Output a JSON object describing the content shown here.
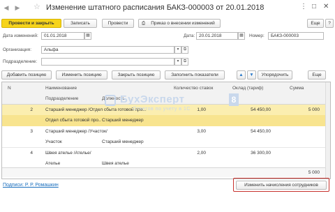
{
  "window": {
    "title": "Изменение штатного расписания БАКЗ-000003 от 20.01.2018",
    "back_icon": "arrow-left-icon",
    "forward_icon": "arrow-right-icon",
    "star_icon": "star-icon",
    "more_icon": "more-icon",
    "maximize_icon": "maximize-icon",
    "close_icon": "close-icon"
  },
  "toolbar": {
    "post_and_close": "Провести и закрыть",
    "save": "Записать",
    "post": "Провести",
    "order": "Приказ о внесении изменений",
    "more": "Еще",
    "help": "?"
  },
  "form": {
    "change_date_label": "Дата изменений:",
    "change_date_value": "01.01.2018",
    "date_label": "Дата:",
    "date_value": "20.01.2018",
    "number_label": "Номер:",
    "number_value": "БАКЗ-000003",
    "org_label": "Организация:",
    "org_value": "Альфа",
    "dept_label": "Подразделение:",
    "dept_value": ""
  },
  "table_toolbar": {
    "add": "Добавить позицию",
    "edit": "Изменить позицию",
    "close": "Закрыть позицию",
    "fill": "Заполнить показатели",
    "up_icon": "arrow-up-icon",
    "down_icon": "arrow-down-icon",
    "sort": "Упорядочить",
    "more": "Еще"
  },
  "table": {
    "headers": {
      "n": "N",
      "name": "Наименование",
      "dept": "Подразделение",
      "position": "Должность",
      "rates": "Количество ставок",
      "salary": "Оклад (тариф)",
      "sum": "Сумма"
    },
    "rows": [
      {
        "n": "2",
        "name": "Старший менеджер /Отдел сбыта готовой про...",
        "rates": "1,00",
        "salary": "54 450,00",
        "sum": "5 000",
        "dept": "Отдел сбыта готовой про...",
        "position": "Старший менеджер"
      },
      {
        "n": "3",
        "name": "Старший менеджер /Участок/",
        "rates": "3,00",
        "salary": "54 450,00",
        "sum": "",
        "dept": "Участок",
        "position": "Старший менеджер"
      },
      {
        "n": "4",
        "name": "Швея ателье /Ателье/",
        "rates": "2,00",
        "salary": "36 300,00",
        "sum": "",
        "dept": "Ателье",
        "position": "Швея ателье"
      }
    ],
    "total_sum": "5 000"
  },
  "watermark": {
    "text": "БухЭксперт",
    "number": "8",
    "subtitle": "Ответов по учету в 1С"
  },
  "footer": {
    "signed": "Подписи: Р. Р. Ромашкин",
    "change_accruals": "Изменить начисления сотрудников"
  }
}
